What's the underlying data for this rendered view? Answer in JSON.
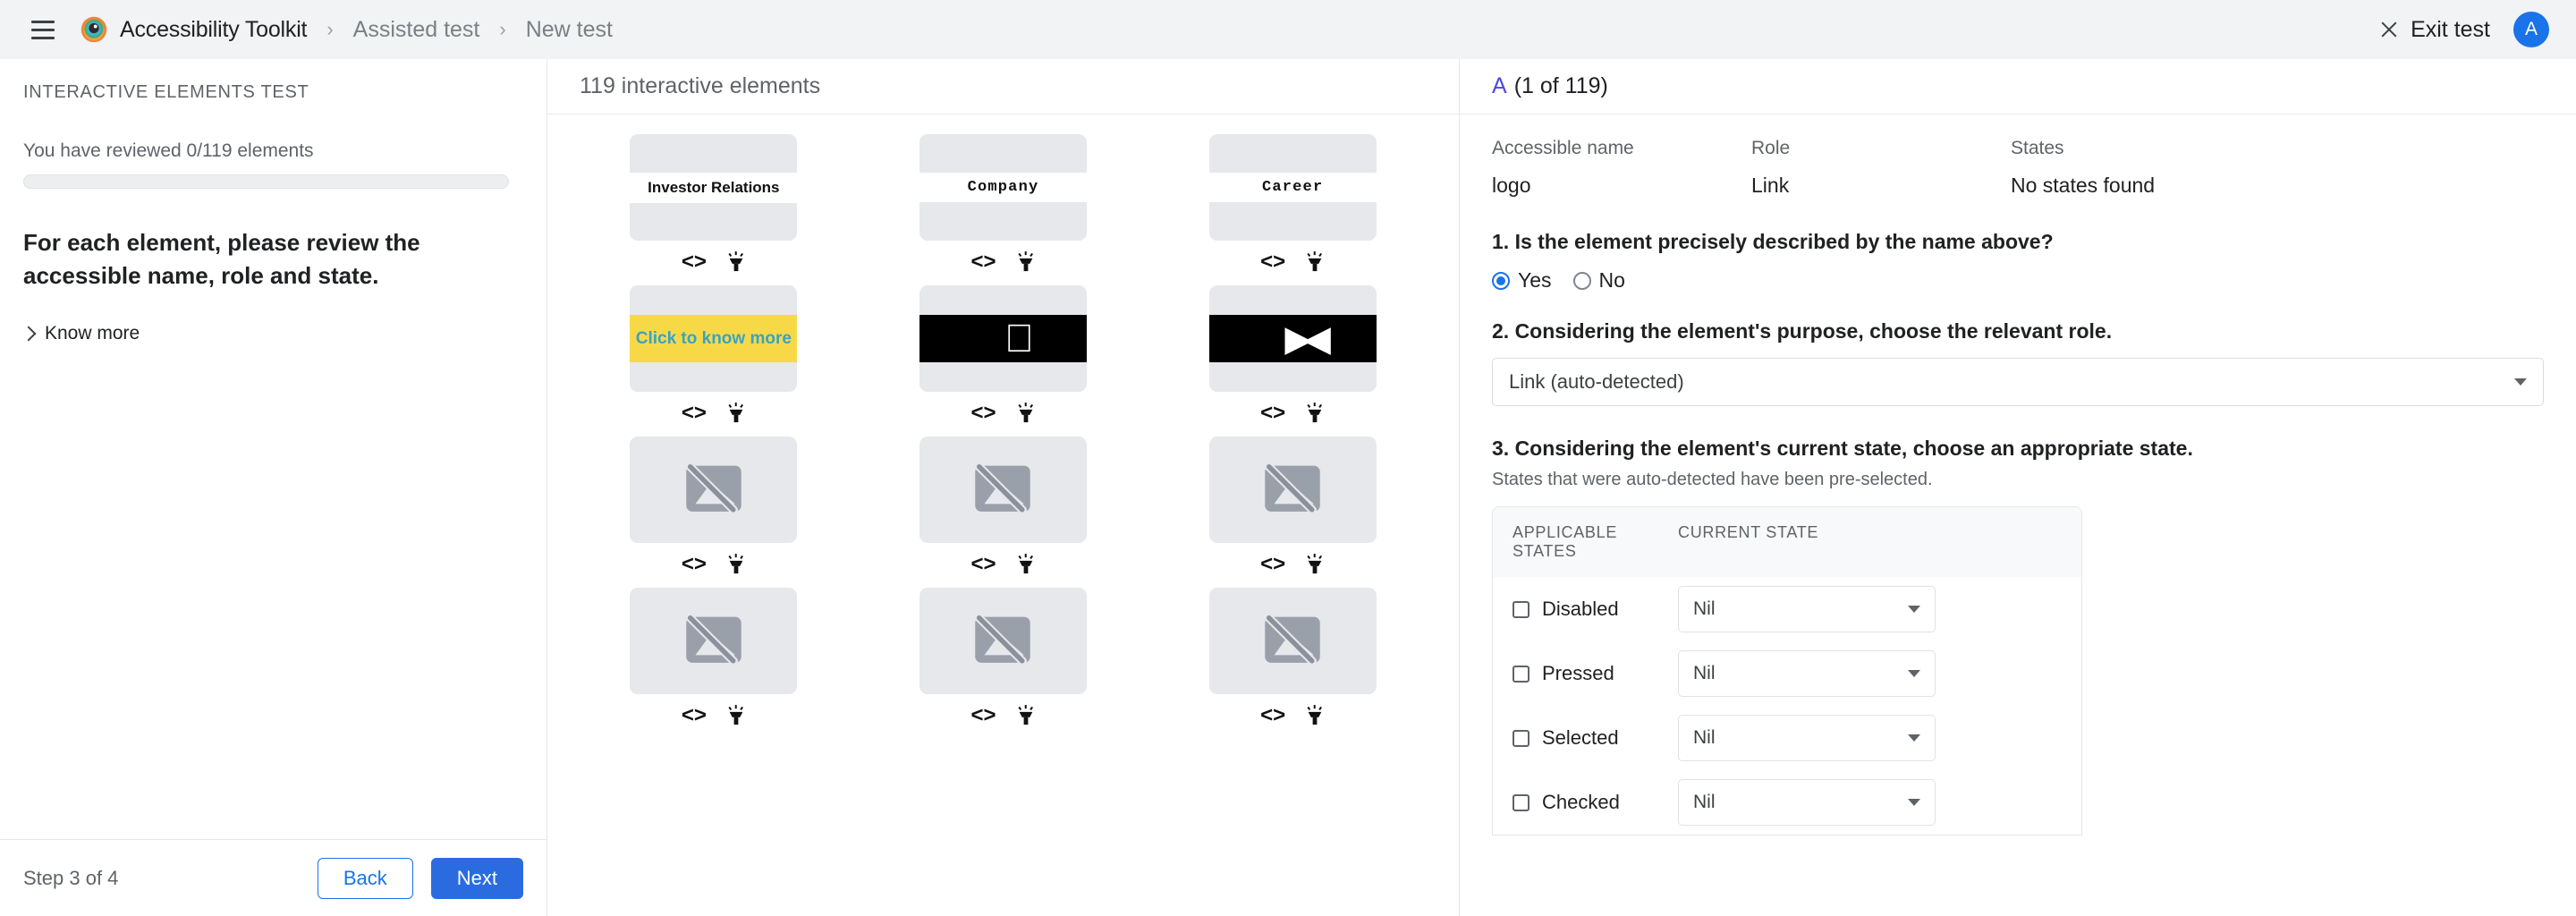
{
  "topbar": {
    "menu_icon": "hamburger-icon",
    "logo_icon": "accessibility-eye-logo",
    "brand": "Accessibility Toolkit",
    "breadcrumb_separator": "›",
    "breadcrumbs": [
      "Assisted test",
      "New test"
    ],
    "exit_icon": "close-icon",
    "exit_label": "Exit test",
    "avatar_initial": "A",
    "avatar_color": "#1a73e8"
  },
  "sidebar": {
    "title": "INTERACTIVE ELEMENTS TEST",
    "reviewed_text": "You have reviewed 0/119 elements",
    "progress_percent": 0,
    "instruction": "For each element, please review the accessible name, role and state.",
    "know_more_label": "Know more",
    "know_more_icon": "chevron-right-icon",
    "step_label": "Step 3 of 4",
    "back_label": "Back",
    "next_label": "Next"
  },
  "middle": {
    "header": "119 interactive elements",
    "code_icon": "code-brackets-icon",
    "marker_icon": "highlighter-icon",
    "cells": [
      {
        "kind": "text",
        "label": "Investor Relations",
        "mono": false
      },
      {
        "kind": "text",
        "label": "Company",
        "mono": true
      },
      {
        "kind": "text",
        "label": "Career",
        "mono": true
      },
      {
        "kind": "highlight",
        "label": "Click to know more"
      },
      {
        "kind": "apple",
        "label": ""
      },
      {
        "kind": "play",
        "label": ""
      },
      {
        "kind": "broken",
        "label": ""
      },
      {
        "kind": "broken",
        "label": ""
      },
      {
        "kind": "broken",
        "label": ""
      },
      {
        "kind": "broken",
        "label": ""
      },
      {
        "kind": "broken",
        "label": ""
      },
      {
        "kind": "broken",
        "label": ""
      }
    ]
  },
  "details": {
    "element_tag": "A",
    "element_count": "(1 of 119)",
    "columns": {
      "accessible_name_header": "Accessible name",
      "role_header": "Role",
      "states_header": "States"
    },
    "values": {
      "accessible_name": "logo",
      "role": "Link",
      "states": "No states found"
    },
    "q1": {
      "text": "1. Is the element precisely described by the name above?",
      "options": [
        "Yes",
        "No"
      ],
      "selected": "Yes"
    },
    "q2": {
      "text": "2. Considering the element's purpose, choose the relevant role.",
      "selected": "Link (auto-detected)"
    },
    "q3": {
      "text": "3. Considering the element's current state, choose an appropriate state.",
      "subtext": "States that were auto-detected have been pre-selected.",
      "table_headers": {
        "applicable": "APPLICABLE STATES",
        "current": "CURRENT STATE"
      },
      "rows": [
        {
          "state": "Disabled",
          "checked": false,
          "current": "Nil"
        },
        {
          "state": "Pressed",
          "checked": false,
          "current": "Nil"
        },
        {
          "state": "Selected",
          "checked": false,
          "current": "Nil"
        },
        {
          "state": "Checked",
          "checked": false,
          "current": "Nil"
        }
      ]
    }
  }
}
